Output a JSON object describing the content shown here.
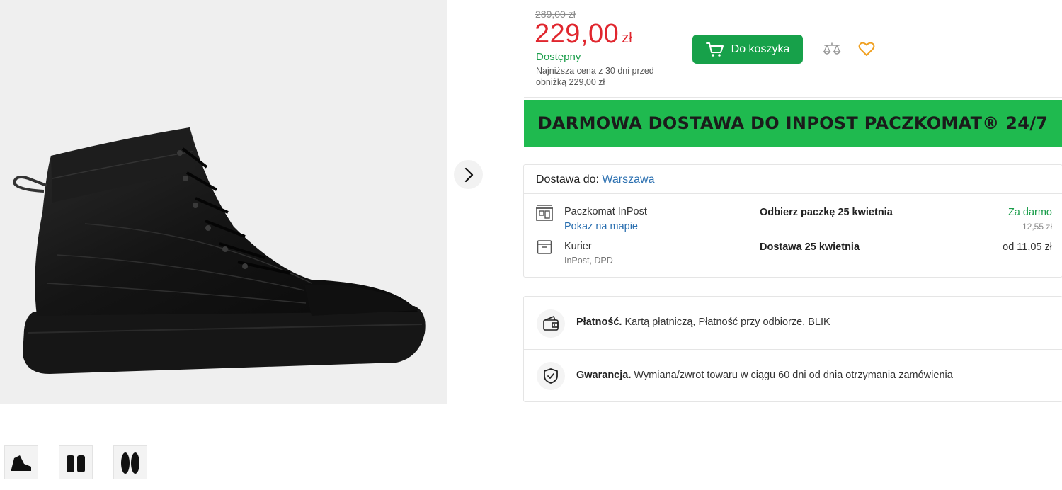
{
  "pricing": {
    "old_price": "289,00 zł",
    "price_amount": "229,00",
    "price_currency": "zł",
    "availability": "Dostępny",
    "lowest_price_note": "Najniższa cena z 30 dni przed obniżką 229,00 zł",
    "cart_button_label": "Do koszyka"
  },
  "banner": {
    "text": "DARMOWA DOSTAWA DO INPOST PACZKOMAT® 24/7"
  },
  "delivery": {
    "label": "Dostawa do:",
    "city": "Warszawa",
    "options": [
      {
        "icon": "parcel-locker-icon",
        "title": "Paczkomat InPost",
        "link": "Pokaż na mapie",
        "date": "Odbierz paczkę 25 kwietnia",
        "price": "Za darmo",
        "old_price": "12,55 zł"
      },
      {
        "icon": "courier-box-icon",
        "title": "Kurier",
        "sub": "InPost, DPD",
        "date": "Dostawa 25 kwietnia",
        "price": "od 11,05 zł"
      }
    ]
  },
  "info": {
    "payment_label": "Płatność.",
    "payment_text": "Kartą płatniczą, Płatność przy odbiorze, BLIK",
    "warranty_label": "Gwarancja.",
    "warranty_text": "Wymiana/zwrot towaru w ciągu 60 dni od dnia otrzymania zamówienia"
  },
  "colors": {
    "price_red": "#e0262e",
    "brand_green": "#17a14a",
    "banner_green": "#1fba4f",
    "link_blue": "#2a6fb0",
    "heart_orange": "#f0a020"
  }
}
